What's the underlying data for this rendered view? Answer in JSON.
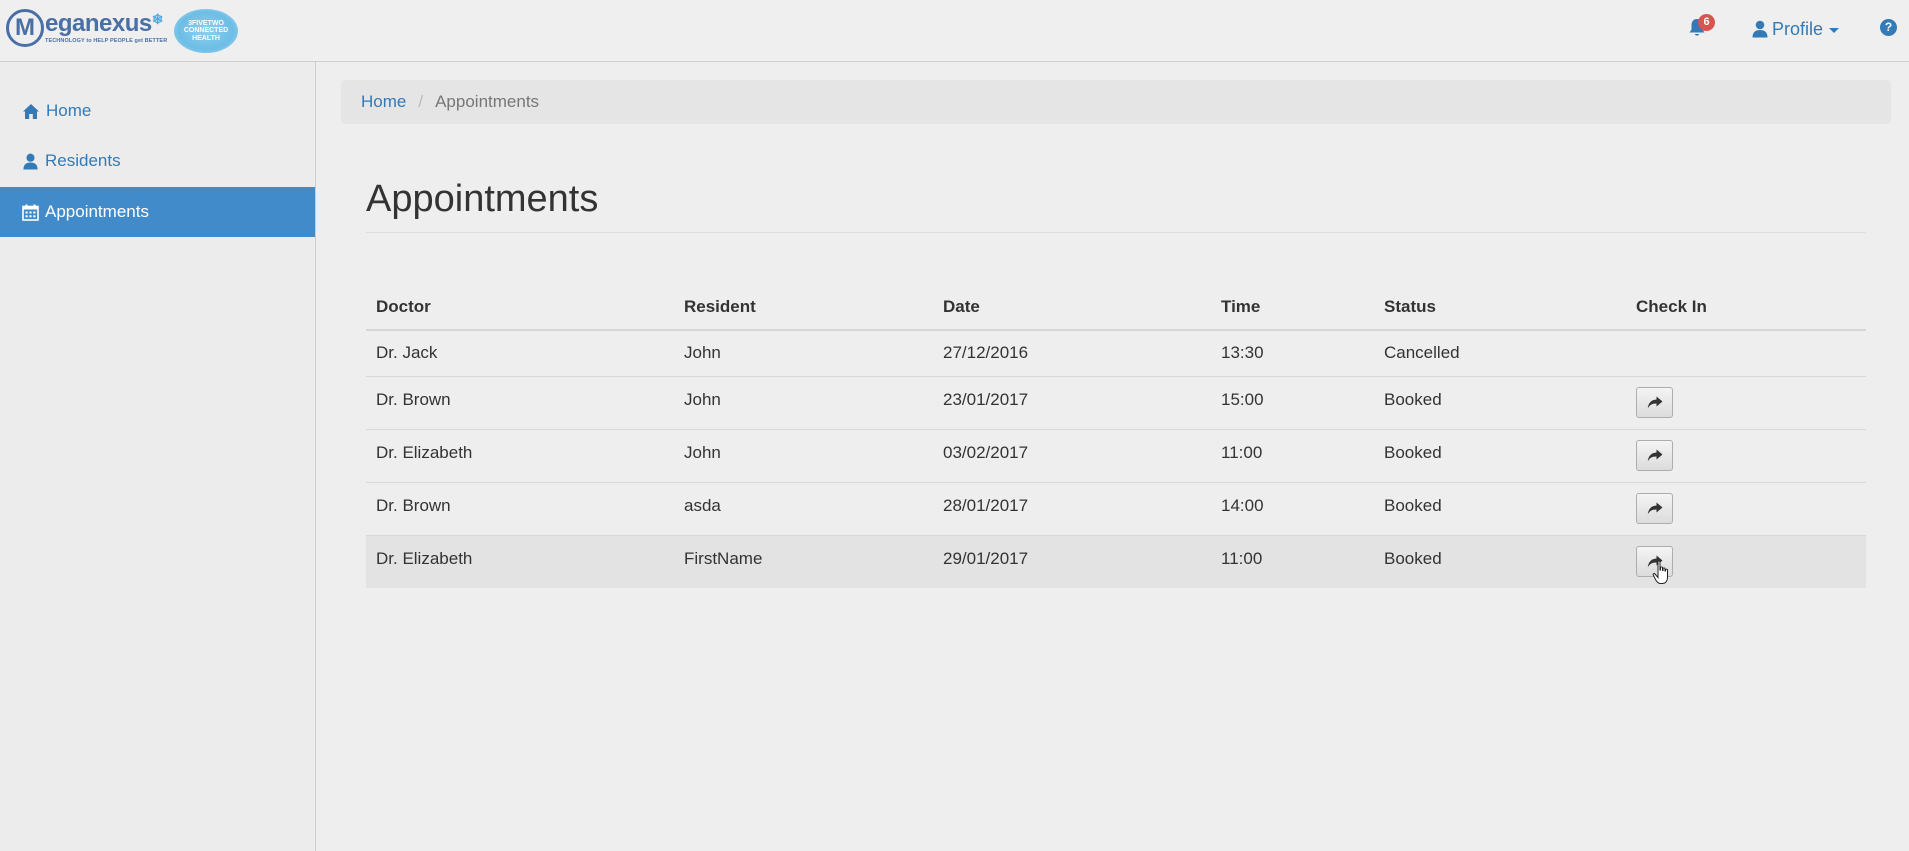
{
  "navbar": {
    "logo": {
      "brand": "eganexus",
      "tagline": "TECHNOLOGY to HELP PEOPLE get BETTER",
      "badge_lines": [
        "3FIVETWO",
        "CONNECTED",
        "HEALTH"
      ]
    },
    "notifications_count": "6",
    "profile_label": "Profile",
    "help_label": "?",
    "icons": {
      "bell": "bell-icon",
      "user": "user-icon",
      "help": "question-circle-icon"
    }
  },
  "sidebar": {
    "items": [
      {
        "label": "Home",
        "icon": "home-icon",
        "active": false
      },
      {
        "label": "Residents",
        "icon": "user-icon",
        "active": false
      },
      {
        "label": "Appointments",
        "icon": "calendar-icon",
        "active": true
      }
    ]
  },
  "breadcrumb": {
    "home": "Home",
    "separator": "/",
    "current": "Appointments"
  },
  "page": {
    "title": "Appointments"
  },
  "table": {
    "headers": {
      "doctor": "Doctor",
      "resident": "Resident",
      "date": "Date",
      "time": "Time",
      "status": "Status",
      "check_in": "Check In"
    },
    "rows": [
      {
        "doctor": "Dr. Jack",
        "resident": "John",
        "date": "27/12/2016",
        "time": "13:30",
        "status": "Cancelled",
        "check_in_button": false
      },
      {
        "doctor": "Dr. Brown",
        "resident": "John",
        "date": "23/01/2017",
        "time": "15:00",
        "status": "Booked",
        "check_in_button": true
      },
      {
        "doctor": "Dr. Elizabeth",
        "resident": "John",
        "date": "03/02/2017",
        "time": "11:00",
        "status": "Booked",
        "check_in_button": true
      },
      {
        "doctor": "Dr. Brown",
        "resident": "asda",
        "date": "28/01/2017",
        "time": "14:00",
        "status": "Booked",
        "check_in_button": true
      },
      {
        "doctor": "Dr. Elizabeth",
        "resident": "FirstName",
        "date": "29/01/2017",
        "time": "11:00",
        "status": "Booked",
        "check_in_button": true
      }
    ],
    "check_in_icon": "share-arrow-icon"
  },
  "colors": {
    "link": "#337ab7",
    "active_nav": "#428bca",
    "cancelled": "#a94442",
    "booked": "#31708f",
    "badge": "#d9534f"
  }
}
